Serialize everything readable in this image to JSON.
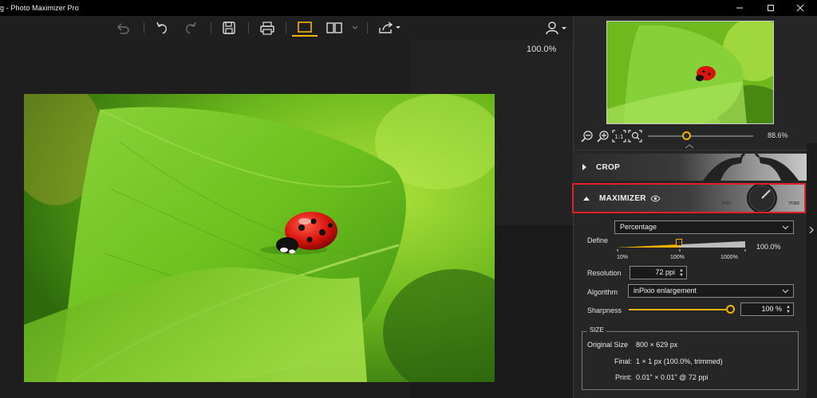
{
  "window": {
    "title": "g - Photo Maximizer Pro",
    "controls": [
      "minimize-icon",
      "maximize-icon",
      "close-icon"
    ]
  },
  "toolbar": {
    "icons": [
      "undo-all-icon",
      "undo-icon",
      "redo-icon",
      "save-icon",
      "print-icon",
      "single-view-icon",
      "split-view-icon",
      "chevron-down-icon",
      "share-icon",
      "account-icon"
    ],
    "accent": "#f5b301"
  },
  "canvas": {
    "zoom_readout": "100.0%"
  },
  "navigator": {
    "zoom_value": "88.6%",
    "zoom_slider_position": 0.37,
    "icons": [
      "zoom-out-icon",
      "zoom-in-icon",
      "actual-size-icon",
      "fit-screen-icon"
    ]
  },
  "crop": {
    "label": "CROP"
  },
  "maximizer": {
    "label": "MAXIMIZER",
    "dial_min": "min",
    "dial_max": "max",
    "highlight_color": "#e0202a"
  },
  "define": {
    "label": "Define",
    "mode": "Percentage",
    "value": "100.0%",
    "slider_position": 0.48,
    "ticks": [
      "10%",
      "100%",
      "1000%"
    ]
  },
  "resolution": {
    "label": "Resolution",
    "value": "72 ppi"
  },
  "algorithm": {
    "label": "Algorithm",
    "value": "inPixio enlargement"
  },
  "sharpness": {
    "label": "Sharpness",
    "value": "100 %",
    "slider_position": 1.0
  },
  "size": {
    "legend": "SIZE",
    "original_label": "Original Size",
    "original_value": "800 × 629 px",
    "final_label": "Final:",
    "final_value": "1 × 1 px (100.0%, trimmed)",
    "print_label": "Print:",
    "print_value": "0.01\" × 0.01\" @ 72 ppi"
  }
}
